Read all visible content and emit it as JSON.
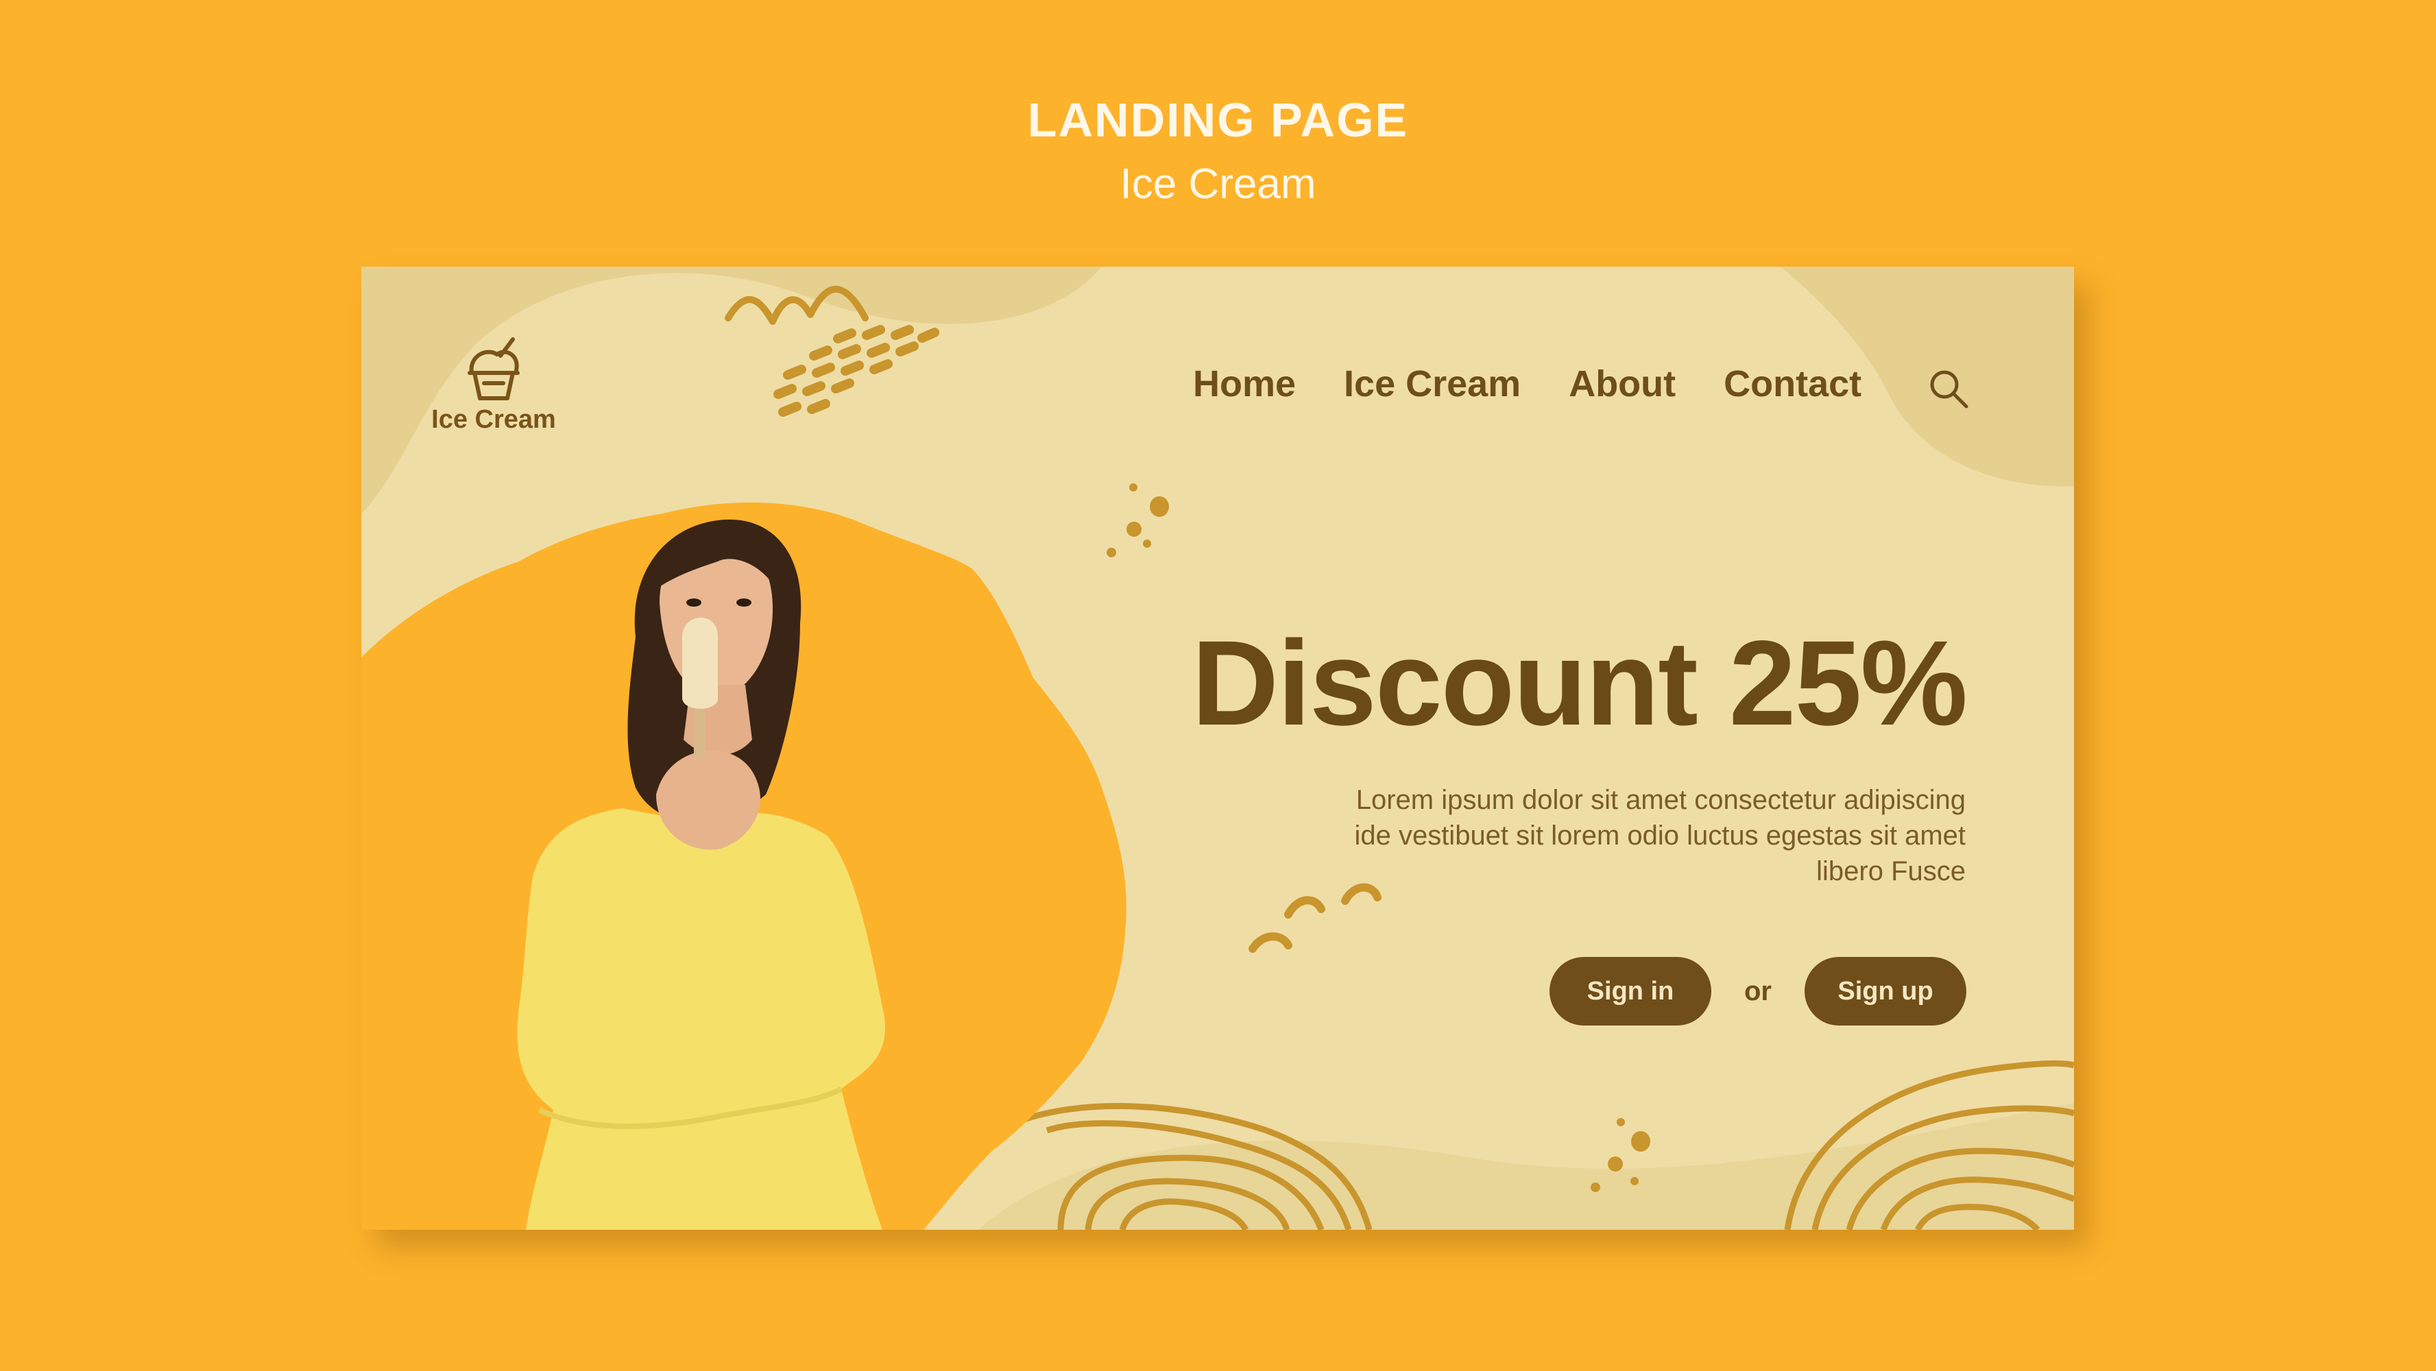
{
  "header": {
    "title": "LANDING PAGE",
    "subtitle": "Ice Cream"
  },
  "logo": {
    "text": "Ice Cream",
    "icon": "ice-cream-cup-icon"
  },
  "nav": {
    "items": [
      "Home",
      "Ice Cream",
      "About",
      "Contact"
    ],
    "search_icon": "search-icon"
  },
  "hero": {
    "title": "Discount 25%",
    "text": "Lorem ipsum dolor sit amet consectetur adipiscing ide vestibuet sit lorem odio luctus egestas sit amet libero Fusce",
    "sign_in": "Sign in",
    "or": "or",
    "sign_up": "Sign up"
  },
  "colors": {
    "page_bg": "#FDB22B",
    "card_bg": "#EFDDA6",
    "accent_dark": "#6F4E1A",
    "doodle": "#C9952D",
    "splash": "#FDB22B"
  }
}
